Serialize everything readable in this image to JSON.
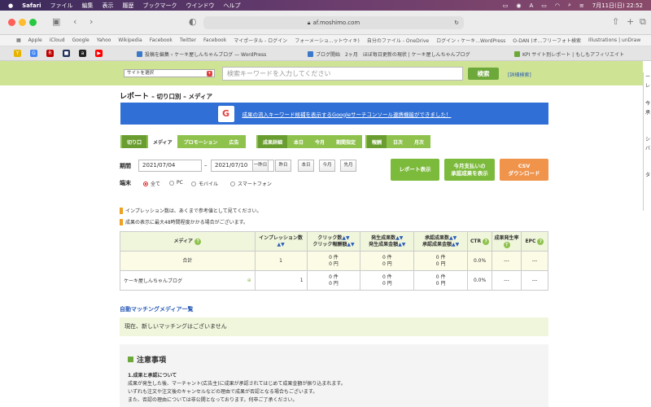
{
  "menubar": {
    "app": "Safari",
    "items": [
      "ファイル",
      "編集",
      "表示",
      "履歴",
      "ブックマーク",
      "ウインドウ",
      "ヘルプ"
    ],
    "datetime": "7月11日(日)  22:52",
    "input_indicator": "A"
  },
  "browser": {
    "url": "af.moshimo.com",
    "favorites": [
      "Apple",
      "iCloud",
      "Google",
      "Yahoo",
      "Wikipedia",
      "Facebook",
      "Twitter",
      "Facebook",
      "マイポータル - ログイン",
      "フォーメーショ...ットウィキ)",
      "自分のファイル - OneDrive",
      "ログイン ‹ ケーキ...WordPress",
      "O-DAN (オ...フリーフォト検索",
      "Illustrations | unDraw"
    ],
    "tabs": [
      {
        "label": "投稿を編集 ‹ ケーキ屋しんちゃんブログ — WordPress"
      },
      {
        "label": "ブログ開始　2ヶ月　ほぼ毎日更新の現状 | ケーキ屋しんちゃんブログ"
      },
      {
        "label": "KPI サイト別レポート | もしもアフィリエイト"
      }
    ]
  },
  "search": {
    "site_select": "サイトを選択",
    "placeholder": "検索キーワードを入力してください",
    "button": "検索",
    "detail_link": "[詳細検索]"
  },
  "right_panel_text": "ー\nレ\n\n今\n承\n\n\nシ\nバ\n\n\nタ",
  "report": {
    "title": "レポート",
    "subtitle": "– 切り口別 – メディア",
    "banner_text": "成果の流入キーワード候補を表示するGoogleサーチコンソール連携機能ができました！",
    "tabs_group1": [
      "切り口",
      "メディア",
      "プロモーション",
      "広告"
    ],
    "tabs_group2": [
      "成果詳細",
      "本日",
      "今月",
      "期間指定"
    ],
    "tabs_group3": [
      "報酬",
      "日次",
      "月次"
    ],
    "period_label": "期間",
    "date_from": "2021/07/04",
    "date_sep": "–",
    "date_to": "2021/07/10",
    "quick": [
      "一昨日",
      "昨日",
      "本日",
      "今月",
      "先月"
    ],
    "device_label": "端末",
    "devices": [
      "全て",
      "PC",
      "モバイル",
      "スマートフォン"
    ],
    "btn_report": "レポート表示",
    "btn_unpaid": "今月支払いの\n承認成果を表示",
    "btn_csv": "CSV\nダウンロード",
    "note1": "インプレッション数は、あくまで参考値として見てください。",
    "note2": "成果の表示に最大48時間程度かかる場合がございます。"
  },
  "table": {
    "headers": {
      "media": "メディア",
      "impressions": "インプレッション数",
      "clicks": "クリック数",
      "click_reward": "クリック報酬額",
      "conversions": "発生成果数",
      "conv_amount": "発生成果金額",
      "approved": "承認成果数",
      "approved_amount": "承認成果金額",
      "ctr": "CTR",
      "conv_rate": "成果発生率",
      "epc": "EPC"
    },
    "help_glyph": "?",
    "sort_glyph": "▲▼",
    "rows": [
      {
        "media": "合計",
        "impressions": "1",
        "clicks": "0 件",
        "click_reward": "0 円",
        "conversions": "0 件",
        "conv_amount": "0 円",
        "approved": "0 件",
        "approved_amount": "0 円",
        "ctr": "0.0%",
        "conv_rate": "---",
        "epc": "---"
      },
      {
        "media": "ケーキ屋しんちゃんブログ",
        "impressions": "1",
        "clicks": "0 件",
        "click_reward": "0 円",
        "conversions": "0 件",
        "conv_amount": "0 円",
        "approved": "0 件",
        "approved_amount": "0 円",
        "ctr": "0.0%",
        "conv_rate": "---",
        "epc": "---"
      }
    ]
  },
  "matching": {
    "title": "自動マッチングメディア一覧",
    "empty": "現在、新しいマッチングはございません"
  },
  "caution": {
    "title": "注意事項",
    "sub": "1.成果と承認について",
    "lines": [
      "成果が発生した後、マーチャント(広告主)に成果が承認されてはじめて成果金額が振り込まれます。",
      "いずれも注文や注文後のキャンセルなどの理由で成果が否認となる場合もございます。",
      "また、否認の理由については非公開となっております。何卒ご了承ください。"
    ]
  },
  "colors": {
    "green_bar": "#cfe395",
    "tab_green": "#8fc24d",
    "btn_green": "#7cba3c",
    "btn_orange": "#f0944c",
    "banner_blue": "#2f6fd6"
  }
}
